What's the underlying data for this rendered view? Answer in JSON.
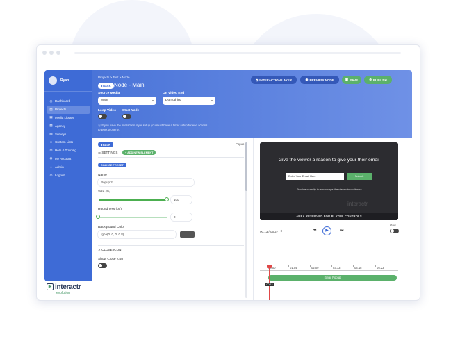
{
  "user": {
    "name": "Ryan"
  },
  "nav": [
    {
      "label": "Dashboard",
      "icon": "◎",
      "active": false
    },
    {
      "label": "Projects",
      "icon": "▤",
      "active": true
    },
    {
      "label": "Media Library",
      "icon": "▣",
      "active": false
    },
    {
      "label": "Agency",
      "icon": "▦",
      "active": false
    },
    {
      "label": "Surveys",
      "icon": "▧",
      "active": false
    },
    {
      "label": "Custom Lists",
      "icon": "≡",
      "active": false
    },
    {
      "label": "Help & Training",
      "icon": "✉",
      "active": false
    },
    {
      "label": "My Account",
      "icon": "◉",
      "active": false
    },
    {
      "label": "Admin",
      "icon": "◌",
      "active": false
    },
    {
      "label": "Logout",
      "icon": "⏻",
      "active": false
    }
  ],
  "logo": {
    "text": "interactr",
    "sub": "evolution"
  },
  "header": {
    "breadcrumb": "Projects  >  Test  >  Node",
    "back_label": "◂ BACK",
    "node_title": "Node - Main",
    "interaction_layer": "INTERACTION LAYER",
    "preview_node": "PREVIEW NODE",
    "save": "SAVE",
    "publish": "PUBLISH",
    "source_media_label": "Source Media",
    "source_media_value": "Main",
    "on_video_end_label": "On Video End",
    "on_video_end_value": "Do nothing",
    "loop_video_label": "Loop Video",
    "start_node_label": "Start Node",
    "note": "ⓘ If you have the interaction layer setup you must have a timer setup for end actions to work properly."
  },
  "panel": {
    "back_label": "◂ BACK",
    "popup_label": "Popup",
    "settings_label": "SETTINGS",
    "add_element": "+ ADD NEW ELEMENT",
    "change_preset": "CHANGE PRESET",
    "name_label": "Name",
    "name_value": "Popup 2",
    "size_label": "Size (%)",
    "size_value": "100",
    "roundness_label": "Roundness (px)",
    "roundness_value": "0",
    "bg_label": "Background Color",
    "bg_value": "rgba(0, 0, 0, 0.8)",
    "close_icon_label": "✕ CLOSE ICON",
    "show_close_label": "Show Close Icon"
  },
  "video": {
    "heading": "Give the viewer a reason to give your their email",
    "input_placeholder": "Enter Your Email Here",
    "submit": "Submit",
    "subtext": "Provide scarcity to encourage the viewer to do it now",
    "footer": "AREA RESERVED FOR PLAYER CONTROLS",
    "watermark": "interactr"
  },
  "controls": {
    "time": "00:13 / 06:27",
    "grid_label": "Grid"
  },
  "timeline": {
    "ticks": [
      "00:00",
      "01:04",
      "02:09",
      "03:13",
      "04:18",
      "05:23"
    ],
    "clip_label": "Email Popup",
    "playhead_label": "00:13"
  },
  "colors": {
    "primary": "#3e6bd6",
    "green": "#5bb16b",
    "accent_red": "#e04848"
  }
}
